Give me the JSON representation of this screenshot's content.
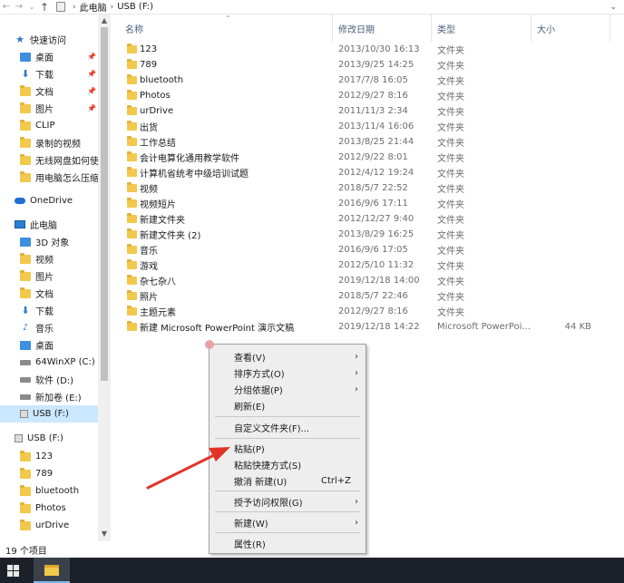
{
  "address": {
    "back_icon": "back-arrow-icon",
    "forward_icon": "forward-arrow-icon",
    "up_icon": "up-arrow-icon",
    "crumbs": [
      "此电脑",
      "USB (F:)"
    ]
  },
  "nav": {
    "items": [
      {
        "label": "快速访问",
        "icon": "star-icon"
      },
      {
        "label": "桌面",
        "icon": "desktop-icon"
      },
      {
        "label": "下载",
        "icon": "download-icon"
      },
      {
        "label": "文档",
        "icon": "document-icon"
      },
      {
        "label": "图片",
        "icon": "pictures-icon"
      },
      {
        "label": "CLIP",
        "icon": "folder-icon"
      },
      {
        "label": "录制的视频",
        "icon": "folder-icon"
      },
      {
        "label": "无线网盘如何使用",
        "icon": "folder-icon"
      },
      {
        "label": "用电脑怎么压缩照片",
        "icon": "folder-icon"
      },
      {
        "label": "OneDrive",
        "icon": "onedrive-icon"
      },
      {
        "label": "此电脑",
        "icon": "computer-icon"
      },
      {
        "label": "3D 对象",
        "icon": "3d-objects-icon"
      },
      {
        "label": "视频",
        "icon": "videos-icon"
      },
      {
        "label": "图片",
        "icon": "pictures-icon"
      },
      {
        "label": "文档",
        "icon": "document-icon"
      },
      {
        "label": "下载",
        "icon": "download-icon"
      },
      {
        "label": "音乐",
        "icon": "music-icon"
      },
      {
        "label": "桌面",
        "icon": "desktop-icon"
      },
      {
        "label": "64WinXP  (C:)",
        "icon": "drive-icon"
      },
      {
        "label": "软件 (D:)",
        "icon": "drive-icon"
      },
      {
        "label": "新加卷 (E:)",
        "icon": "drive-icon"
      },
      {
        "label": "USB (F:)",
        "icon": "usb-drive-icon"
      },
      {
        "label": "USB (F:)",
        "icon": "usb-drive-icon"
      },
      {
        "label": "123",
        "icon": "folder-icon"
      },
      {
        "label": "789",
        "icon": "folder-icon"
      },
      {
        "label": "bluetooth",
        "icon": "folder-icon"
      },
      {
        "label": "Photos",
        "icon": "folder-icon"
      },
      {
        "label": "urDrive",
        "icon": "folder-icon"
      }
    ]
  },
  "columns": {
    "name": "名称",
    "date": "修改日期",
    "type": "类型",
    "size": "大小"
  },
  "files": [
    {
      "name": "123",
      "date": "2013/10/30 16:13",
      "type": "文件夹",
      "size": ""
    },
    {
      "name": "789",
      "date": "2013/9/25 14:25",
      "type": "文件夹",
      "size": ""
    },
    {
      "name": "bluetooth",
      "date": "2017/7/8 16:05",
      "type": "文件夹",
      "size": ""
    },
    {
      "name": "Photos",
      "date": "2012/9/27 8:16",
      "type": "文件夹",
      "size": ""
    },
    {
      "name": "urDrive",
      "date": "2011/11/3 2:34",
      "type": "文件夹",
      "size": ""
    },
    {
      "name": "出货",
      "date": "2013/11/4 16:06",
      "type": "文件夹",
      "size": ""
    },
    {
      "name": "工作总结",
      "date": "2013/8/25 21:44",
      "type": "文件夹",
      "size": ""
    },
    {
      "name": "会计电算化通用教学软件",
      "date": "2012/9/22 8:01",
      "type": "文件夹",
      "size": ""
    },
    {
      "name": "计算机省统考中级培训试题",
      "date": "2012/4/12 19:24",
      "type": "文件夹",
      "size": ""
    },
    {
      "name": "视频",
      "date": "2018/5/7 22:52",
      "type": "文件夹",
      "size": ""
    },
    {
      "name": "视频短片",
      "date": "2016/9/6 17:11",
      "type": "文件夹",
      "size": ""
    },
    {
      "name": "新建文件夹",
      "date": "2012/12/27 9:40",
      "type": "文件夹",
      "size": ""
    },
    {
      "name": "新建文件夹 (2)",
      "date": "2013/8/29 16:25",
      "type": "文件夹",
      "size": ""
    },
    {
      "name": "音乐",
      "date": "2016/9/6 17:05",
      "type": "文件夹",
      "size": ""
    },
    {
      "name": "游戏",
      "date": "2012/5/10 11:32",
      "type": "文件夹",
      "size": ""
    },
    {
      "name": "杂七杂八",
      "date": "2019/12/18 14:00",
      "type": "文件夹",
      "size": ""
    },
    {
      "name": "照片",
      "date": "2018/5/7 22:46",
      "type": "文件夹",
      "size": ""
    },
    {
      "name": "主题元素",
      "date": "2012/9/27 8:16",
      "type": "文件夹",
      "size": ""
    },
    {
      "name": "新建 Microsoft PowerPoint 演示文稿",
      "date": "2019/12/18 14:22",
      "type": "Microsoft PowerPoi...",
      "size": "44 KB"
    }
  ],
  "status": {
    "count": "19 个项目"
  },
  "context_menu": {
    "view": "查看(V)",
    "sort": "排序方式(O)",
    "group": "分组依据(P)",
    "refresh": "刷新(E)",
    "customize": "自定义文件夹(F)...",
    "paste": "粘贴(P)",
    "paste_shortcut": "粘贴快捷方式(S)",
    "undo": "撤消 新建(U)",
    "undo_shortcut": "Ctrl+Z",
    "give_access": "授予访问权限(G)",
    "new": "新建(W)",
    "properties": "属性(R)"
  },
  "colors": {
    "accent_arrow": "#e0342a",
    "selection": "#cce8ff",
    "taskbar": "#1c2129"
  }
}
